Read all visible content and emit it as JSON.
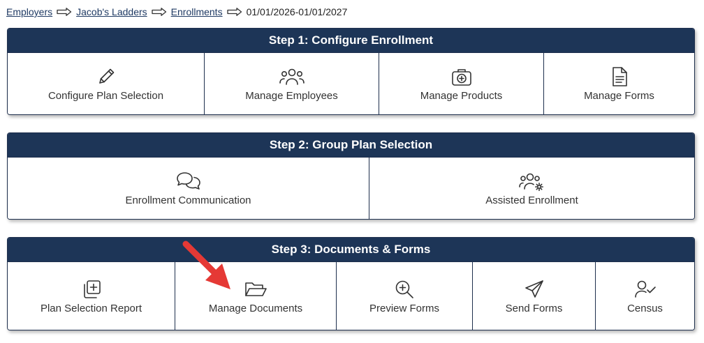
{
  "breadcrumb": {
    "items": [
      "Employers",
      "Jacob's Ladders",
      "Enrollments"
    ],
    "current": "01/01/2026-01/01/2027"
  },
  "step1": {
    "title": "Step 1: Configure Enrollment",
    "tiles": [
      {
        "label": "Configure Plan Selection",
        "icon": "pencil-icon"
      },
      {
        "label": "Manage Employees",
        "icon": "users-icon"
      },
      {
        "label": "Manage Products",
        "icon": "medical-kit-icon"
      },
      {
        "label": "Manage Forms",
        "icon": "document-icon"
      }
    ]
  },
  "step2": {
    "title": "Step 2: Group Plan Selection",
    "tiles": [
      {
        "label": "Enrollment Communication",
        "icon": "chat-bubbles-icon"
      },
      {
        "label": "Assisted Enrollment",
        "icon": "users-gear-icon"
      }
    ]
  },
  "step3": {
    "title": "Step 3: Documents & Forms",
    "tiles": [
      {
        "label": "Plan Selection Report",
        "icon": "copy-plus-icon"
      },
      {
        "label": "Manage Documents",
        "icon": "folder-open-icon"
      },
      {
        "label": "Preview Forms",
        "icon": "zoom-in-icon"
      },
      {
        "label": "Send Forms",
        "icon": "paper-plane-icon"
      },
      {
        "label": "Census",
        "icon": "user-check-icon"
      }
    ]
  },
  "colors": {
    "header_bg": "#1d3557",
    "link": "#1f3a63",
    "annotation_arrow": "#e53935"
  }
}
